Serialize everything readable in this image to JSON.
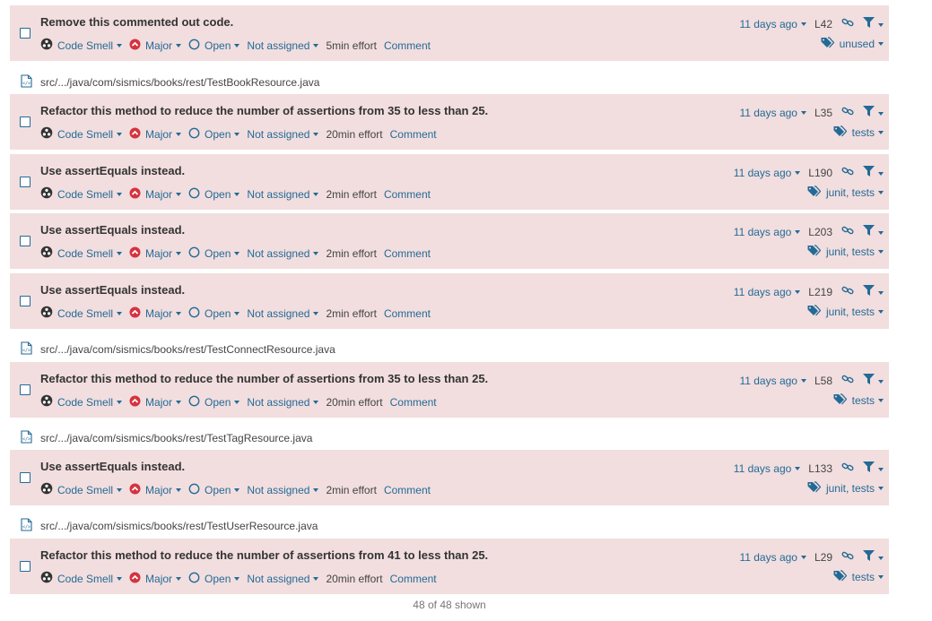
{
  "issues": [
    {
      "message": "Remove this commented out code.",
      "type": "Code Smell",
      "severity": "Major",
      "status": "Open",
      "assignee": "Not assigned",
      "effort": "5min effort",
      "comment": "Comment",
      "date": "11 days ago",
      "line": "L42",
      "tags": "unused"
    },
    {
      "message": "Refactor this method to reduce the number of assertions from 35 to less than 25.",
      "type": "Code Smell",
      "severity": "Major",
      "status": "Open",
      "assignee": "Not assigned",
      "effort": "20min effort",
      "comment": "Comment",
      "date": "11 days ago",
      "line": "L35",
      "tags": "tests"
    },
    {
      "message": "Use assertEquals instead.",
      "type": "Code Smell",
      "severity": "Major",
      "status": "Open",
      "assignee": "Not assigned",
      "effort": "2min effort",
      "comment": "Comment",
      "date": "11 days ago",
      "line": "L190",
      "tags": "junit, tests"
    },
    {
      "message": "Use assertEquals instead.",
      "type": "Code Smell",
      "severity": "Major",
      "status": "Open",
      "assignee": "Not assigned",
      "effort": "2min effort",
      "comment": "Comment",
      "date": "11 days ago",
      "line": "L203",
      "tags": "junit, tests"
    },
    {
      "message": "Use assertEquals instead.",
      "type": "Code Smell",
      "severity": "Major",
      "status": "Open",
      "assignee": "Not assigned",
      "effort": "2min effort",
      "comment": "Comment",
      "date": "11 days ago",
      "line": "L219",
      "tags": "junit, tests"
    },
    {
      "message": "Refactor this method to reduce the number of assertions from 35 to less than 25.",
      "type": "Code Smell",
      "severity": "Major",
      "status": "Open",
      "assignee": "Not assigned",
      "effort": "20min effort",
      "comment": "Comment",
      "date": "11 days ago",
      "line": "L58",
      "tags": "tests"
    },
    {
      "message": "Use assertEquals instead.",
      "type": "Code Smell",
      "severity": "Major",
      "status": "Open",
      "assignee": "Not assigned",
      "effort": "2min effort",
      "comment": "Comment",
      "date": "11 days ago",
      "line": "L133",
      "tags": "junit, tests"
    },
    {
      "message": "Refactor this method to reduce the number of assertions from 41 to less than 25.",
      "type": "Code Smell",
      "severity": "Major",
      "status": "Open",
      "assignee": "Not assigned",
      "effort": "20min effort",
      "comment": "Comment",
      "date": "11 days ago",
      "line": "L29",
      "tags": "tests"
    }
  ],
  "files": [
    "src/.../java/com/sismics/books/rest/TestBookResource.java",
    "src/.../java/com/sismics/books/rest/TestConnectResource.java",
    "src/.../java/com/sismics/books/rest/TestTagResource.java",
    "src/.../java/com/sismics/books/rest/TestUserResource.java"
  ],
  "footer": {
    "shown": "48 of 48 shown"
  },
  "colors": {
    "issue_bg": "#f2dede",
    "link": "#236a97",
    "severity_major": "#d4333f"
  }
}
